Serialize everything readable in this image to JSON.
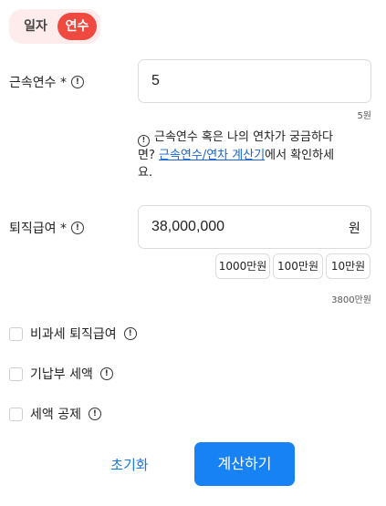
{
  "mode_toggle": {
    "option_date": "일자",
    "option_years": "연수",
    "selected": "연수"
  },
  "service_years": {
    "label": "근속연수 *",
    "value": "5",
    "hint": "5원"
  },
  "service_note": {
    "text_before": "근속연수 혹은 나의 연차가 궁금하다면? ",
    "link": "근속연수/연차 계산기",
    "text_after": "에서 확인하세요."
  },
  "retirement_pay": {
    "label": "퇴직급여 *",
    "value": "38,000,000",
    "unit": "원",
    "chips": [
      "1000만원",
      "100만원",
      "10만원"
    ],
    "hint": "3800만원"
  },
  "options": [
    {
      "label": "비과세 퇴직급여",
      "checked": false
    },
    {
      "label": "기납부 세액",
      "checked": false
    },
    {
      "label": "세액 공제",
      "checked": false
    }
  ],
  "actions": {
    "reset": "초기화",
    "calculate": "계산하기"
  },
  "colors": {
    "accent_red": "#f0493f",
    "accent_blue": "#1682f3",
    "link_blue": "#1a64d4"
  }
}
